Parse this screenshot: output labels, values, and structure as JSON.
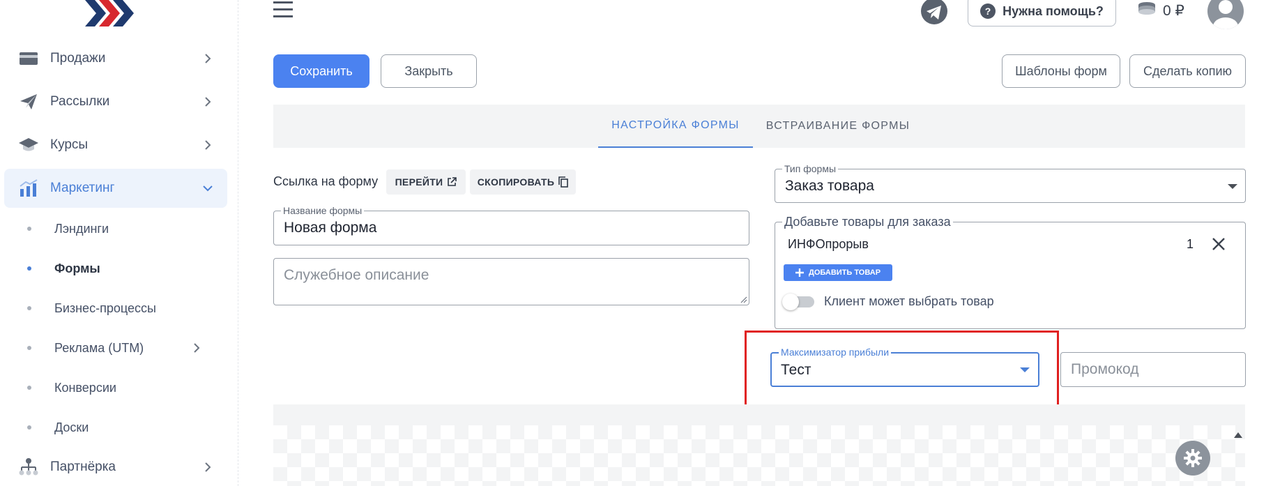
{
  "sidebar": {
    "items": [
      {
        "label": "Продажи",
        "icon": "wallet-icon"
      },
      {
        "label": "Рассылки",
        "icon": "paper-plane-icon"
      },
      {
        "label": "Курсы",
        "icon": "graduation-cap-icon"
      },
      {
        "label": "Маркетинг",
        "icon": "chart-icon",
        "expanded": true
      },
      {
        "label": "Партнёрка",
        "icon": "sitemap-icon"
      }
    ],
    "subitems": [
      {
        "label": "Лэндинги"
      },
      {
        "label": "Формы",
        "current": true
      },
      {
        "label": "Бизнес-процессы"
      },
      {
        "label": "Реклама (UTM)"
      },
      {
        "label": "Конверсии"
      },
      {
        "label": "Доски"
      }
    ]
  },
  "header": {
    "help_label": "Нужна помощь?",
    "balance": "0 ₽"
  },
  "toolbar": {
    "save_label": "Сохранить",
    "close_label": "Закрыть",
    "templates_label": "Шаблоны форм",
    "copy_label": "Сделать копию"
  },
  "tabs": [
    {
      "label": "НАСТРОЙКА ФОРМЫ",
      "active": true
    },
    {
      "label": "ВСТРАИВАНИЕ ФОРМЫ",
      "active": false
    }
  ],
  "form": {
    "link_label": "Ссылка на форму",
    "goto_label": "ПЕРЕЙТИ",
    "copy_link_label": "СКОПИРОВАТЬ",
    "name_legend": "Название формы",
    "name_value": "Новая форма",
    "description_placeholder": "Служебное описание",
    "type_legend": "Тип формы",
    "type_value": "Заказ товара",
    "products_legend": "Добавьте товары для заказа",
    "product_name": "ИНФОпрорыв",
    "product_qty": "1",
    "add_product_label": "ДОБАВИТЬ ТОВАР",
    "client_choose_label": "Клиент может выбрать товар",
    "client_choose_enabled": false,
    "maximizer_legend": "Максимизатор прибыли",
    "maximizer_value": "Тест",
    "promo_placeholder": "Промокод"
  },
  "colors": {
    "accent": "#4b82f0",
    "active_nav_bg": "#edf3fc",
    "highlight": "#e02020"
  }
}
